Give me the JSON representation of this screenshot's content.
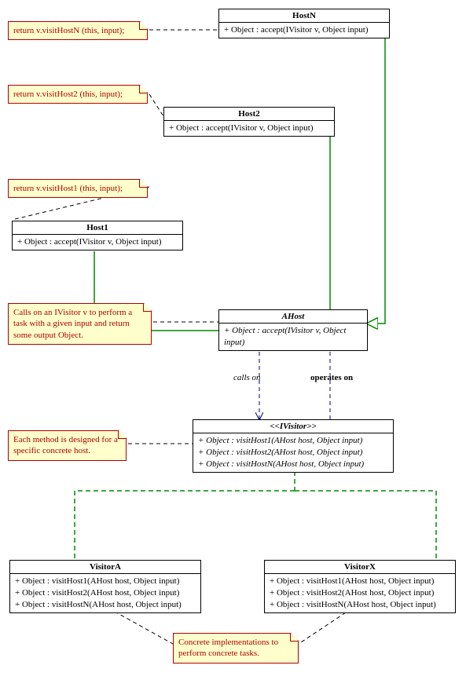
{
  "classes": {
    "hostN": {
      "name": "HostN",
      "methods": [
        "+ Object : accept(IVisitor v, Object input)"
      ]
    },
    "host2": {
      "name": "Host2",
      "methods": [
        "+ Object : accept(IVisitor v, Object input)"
      ]
    },
    "host1": {
      "name": "Host1",
      "methods": [
        "+ Object : accept(IVisitor v, Object input)"
      ]
    },
    "ahost": {
      "name": "AHost",
      "methods": [
        "+ Object : accept(IVisitor v, Object input)"
      ]
    },
    "ivisitor": {
      "name": "<<IVisitor>>",
      "methods": [
        "+ Object : visitHost1(AHost host, Object input)",
        "+ Object : visitHost2(AHost host, Object input)",
        "+ Object : visitHostN(AHost host, Object input)"
      ]
    },
    "visitorA": {
      "name": "VisitorA",
      "methods": [
        "+ Object : visitHost1(AHost host, Object input)",
        "+ Object : visitHost2(AHost host, Object input)",
        "+ Object : visitHostN(AHost host, Object input)"
      ]
    },
    "visitorX": {
      "name": "VisitorX",
      "methods": [
        "+ Object : visitHost1(AHost host, Object input)",
        "+ Object : visitHost2(AHost host, Object input)",
        "+ Object : visitHostN(AHost host, Object input)"
      ]
    }
  },
  "notes": {
    "hostN": "return v.visitHostN (this, input);",
    "host2": "return v.visitHost2 (this, input);",
    "host1": "return v.visitHost1 (this, input);",
    "ahost": "Calls on an IVisitor v to perform a task with a given input and return some output Object.",
    "ivisitor": "Each method is designed for a specific concrete host.",
    "visitors": "Concrete implementations to perform concrete tasks."
  },
  "rel": {
    "callsOn": "calls on",
    "operatesOn": "operates on"
  }
}
